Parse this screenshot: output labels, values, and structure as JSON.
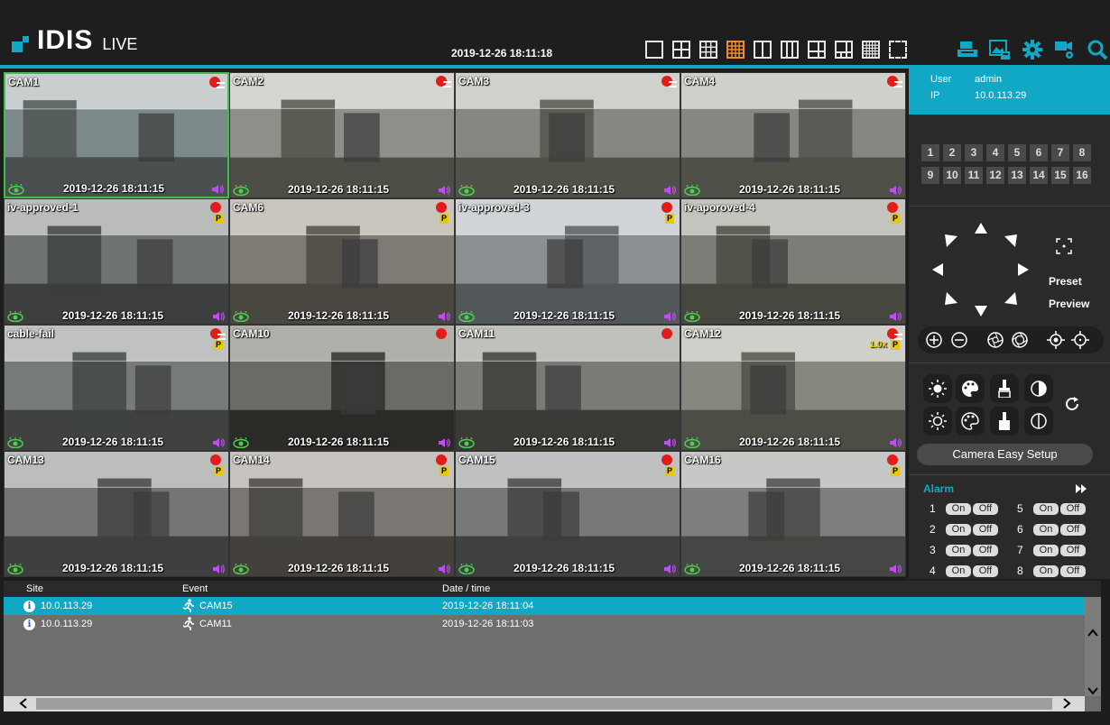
{
  "header": {
    "brand": "IDIS",
    "mode": "LIVE",
    "datetime": "2019-12-26 18:11:18",
    "layout_buttons": [
      {
        "name": "layout-1x1-icon",
        "active": false
      },
      {
        "name": "layout-2x2-icon",
        "active": false
      },
      {
        "name": "layout-3x3-icon",
        "active": false
      },
      {
        "name": "layout-4x4-icon",
        "active": true
      },
      {
        "name": "layout-1plus2-icon",
        "active": false
      },
      {
        "name": "layout-1plus3-icon",
        "active": false
      },
      {
        "name": "layout-1plus5-icon",
        "active": false
      },
      {
        "name": "layout-1plus7-icon",
        "active": false
      },
      {
        "name": "layout-5x5-icon",
        "active": false
      },
      {
        "name": "fullscreen-icon",
        "active": false
      }
    ],
    "tools": [
      "print-icon",
      "image-export-icon",
      "settings-gear-icon",
      "camera-settings-icon",
      "search-icon"
    ],
    "accent_color": "#11a8c6",
    "active_color": "#f28a2a"
  },
  "cameras": [
    {
      "title": "CAM1",
      "time": "2019-12-26 18:11:15",
      "status": "rec-lines",
      "p": false,
      "zoom": "",
      "selected": true
    },
    {
      "title": "CAM2",
      "time": "2019-12-26 18:11:15",
      "status": "rec-lines",
      "p": false,
      "zoom": ""
    },
    {
      "title": "CAM3",
      "time": "2019-12-26 18:11:15",
      "status": "rec-lines",
      "p": false,
      "zoom": ""
    },
    {
      "title": "CAM4",
      "time": "2019-12-26 18:11:15",
      "status": "rec-lines",
      "p": false,
      "zoom": ""
    },
    {
      "title": "iv-approved-1",
      "time": "2019-12-26 18:11:15",
      "status": "rec",
      "p": true,
      "zoom": ""
    },
    {
      "title": "CAM6",
      "time": "2019-12-26 18:11:15",
      "status": "rec",
      "p": true,
      "zoom": ""
    },
    {
      "title": "iv-approved-3",
      "time": "2019-12-26 18:11:15",
      "status": "rec",
      "p": true,
      "zoom": ""
    },
    {
      "title": "iv-aporoved-4",
      "time": "2019-12-26 18:11:15",
      "status": "rec",
      "p": true,
      "zoom": ""
    },
    {
      "title": "cable-fail",
      "time": "2019-12-26 18:11:15",
      "status": "rec-lines",
      "p": true,
      "zoom": ""
    },
    {
      "title": "CAM10",
      "time": "2019-12-26 18:11:15",
      "status": "rec",
      "p": false,
      "zoom": ""
    },
    {
      "title": "CAM11",
      "time": "2019-12-26 18:11:15",
      "status": "rec",
      "p": false,
      "zoom": ""
    },
    {
      "title": "CAM12",
      "time": "2019-12-26 18:11:15",
      "status": "rec-lines",
      "p": true,
      "zoom": "1.0x"
    },
    {
      "title": "CAM13",
      "time": "2019-12-26 18:11:15",
      "status": "rec",
      "p": true,
      "zoom": ""
    },
    {
      "title": "CAM14",
      "time": "2019-12-26 18:11:15",
      "status": "rec",
      "p": true,
      "zoom": ""
    },
    {
      "title": "CAM15",
      "time": "2019-12-26 18:11:15",
      "status": "rec",
      "p": true,
      "zoom": ""
    },
    {
      "title": "CAM16",
      "time": "2019-12-26 18:11:15",
      "status": "rec",
      "p": true,
      "zoom": ""
    }
  ],
  "p_badge": "P",
  "user_panel": {
    "user_label": "User",
    "user_value": "admin",
    "ip_label": "IP",
    "ip_value": "10.0.113.29"
  },
  "camera_numbers": [
    "1",
    "2",
    "3",
    "4",
    "5",
    "6",
    "7",
    "8",
    "9",
    "10",
    "11",
    "12",
    "13",
    "14",
    "15",
    "16"
  ],
  "ptz": {
    "preset_label": "Preset",
    "preview_label": "Preview"
  },
  "easy_setup_label": "Camera Easy Setup",
  "alarm": {
    "title": "Alarm",
    "on_label": "On",
    "off_label": "Off",
    "outputs": [
      "1",
      "2",
      "3",
      "4",
      "5",
      "6",
      "7",
      "8"
    ]
  },
  "events": {
    "columns": {
      "site": "Site",
      "event": "Event",
      "datetime": "Date / time"
    },
    "rows": [
      {
        "site": "10.0.113.29",
        "event": "CAM15",
        "datetime": "2019-12-26 18:11:04",
        "selected": true
      },
      {
        "site": "10.0.113.29",
        "event": "CAM11",
        "datetime": "2019-12-26 18:11:03",
        "selected": false
      }
    ],
    "info_glyph": "i"
  }
}
